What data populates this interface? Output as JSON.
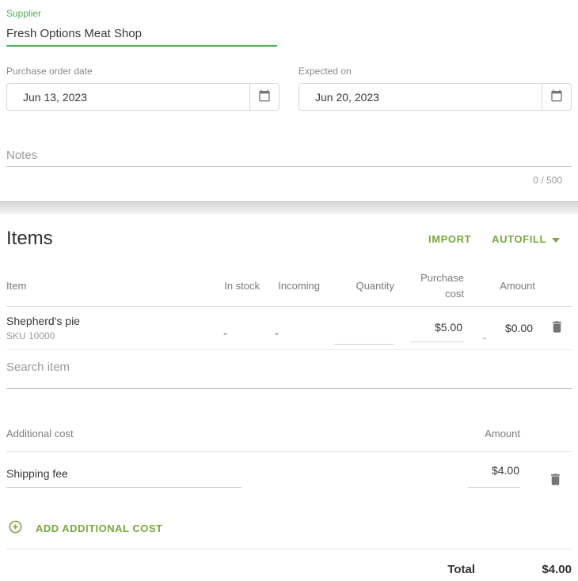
{
  "colors": {
    "accent_green_buttons": "#77a93d",
    "supplier_green": "#4bae4f",
    "text_dark": "#3a3a3a",
    "text_gray": "#7a7a7a"
  },
  "supplier": {
    "label": "Supplier",
    "value": "Fresh Options Meat Shop"
  },
  "order_dates": {
    "purchase": {
      "label": "Purchase order date",
      "value": "Jun 13, 2023"
    },
    "expected": {
      "label": "Expected on",
      "value": "Jun 20, 2023"
    }
  },
  "notes": {
    "placeholder": "Notes",
    "counter": "0 / 500"
  },
  "items": {
    "title": "Items",
    "import_button": "IMPORT",
    "autofill_button": "AUTOFILL",
    "columns": [
      "Item",
      "In stock",
      "Incoming",
      "Quantity",
      "Purchase cost",
      "Amount"
    ],
    "rows": [
      {
        "name": "Shepherd's pie",
        "sku": "SKU 10000",
        "in_stock": "-",
        "incoming": "-",
        "quantity": "",
        "purchase_cost": "$5.00",
        "amount": "$0.00"
      }
    ],
    "search_placeholder": "Search item"
  },
  "additional_costs": {
    "name_header": "Additional cost",
    "amount_header": "Amount",
    "rows": [
      {
        "name": "Shipping fee",
        "amount": "$4.00"
      }
    ],
    "add_button": "ADD ADDITIONAL COST"
  },
  "summary": {
    "total_label": "Total",
    "total_value": "$4.00"
  }
}
